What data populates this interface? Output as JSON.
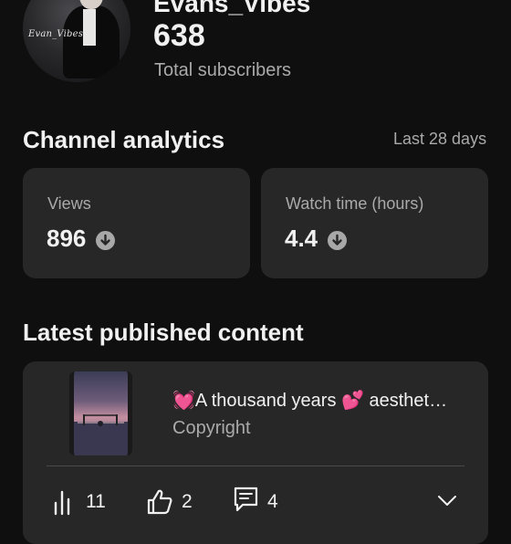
{
  "header": {
    "channel_name": "Evans_Vibes",
    "avatar_signature": "Evan_Vibes",
    "subscriber_count": "638",
    "subscriber_label": "Total subscribers"
  },
  "analytics": {
    "title": "Channel analytics",
    "range": "Last 28 days",
    "cards": [
      {
        "label": "Views",
        "value": "896",
        "trend": "down"
      },
      {
        "label": "Watch time (hours)",
        "value": "4.4",
        "trend": "down"
      }
    ]
  },
  "latest": {
    "title": "Latest published content",
    "video": {
      "title": "💓A thousand years 💕 aesthet…",
      "subtitle": "Copyright",
      "stats": {
        "views": "11",
        "likes": "2",
        "comments": "4"
      }
    }
  },
  "colors": {
    "background": "#0f0f0f",
    "card": "#272727",
    "secondary_text": "#aaaaaa",
    "primary_text": "#f1f1f1"
  }
}
